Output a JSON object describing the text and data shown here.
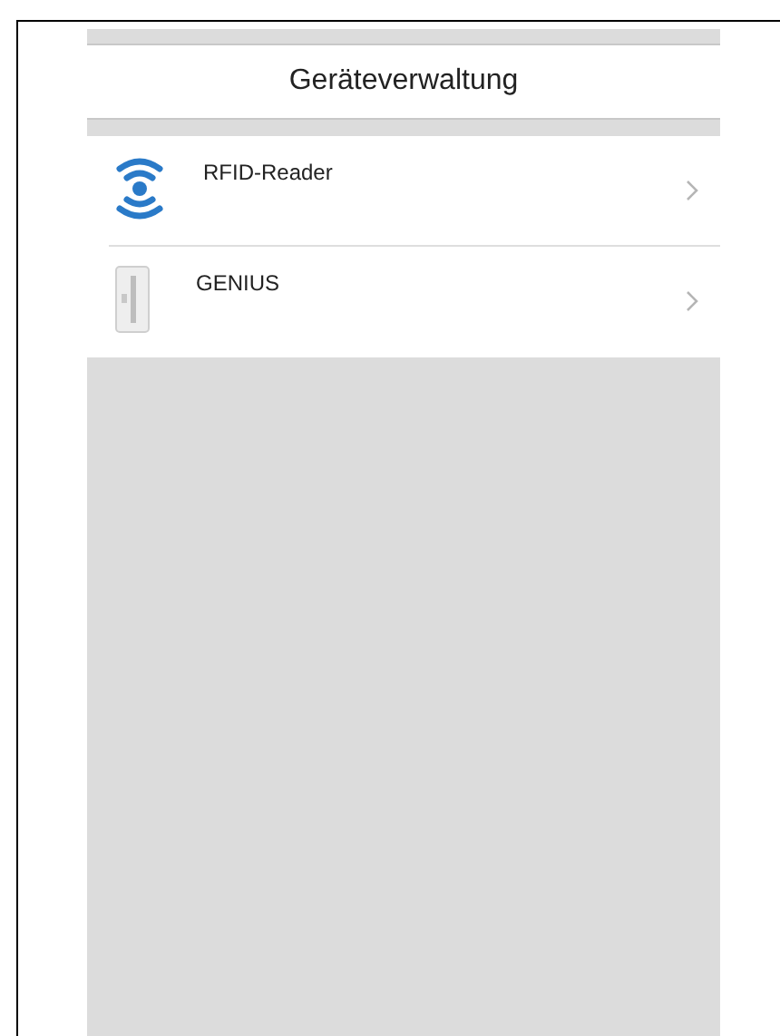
{
  "title": "Geräteverwaltung",
  "devices": [
    {
      "kind": "rfid",
      "name": "RFID-Reader"
    },
    {
      "kind": "lock",
      "name": "GENIUS"
    }
  ]
}
